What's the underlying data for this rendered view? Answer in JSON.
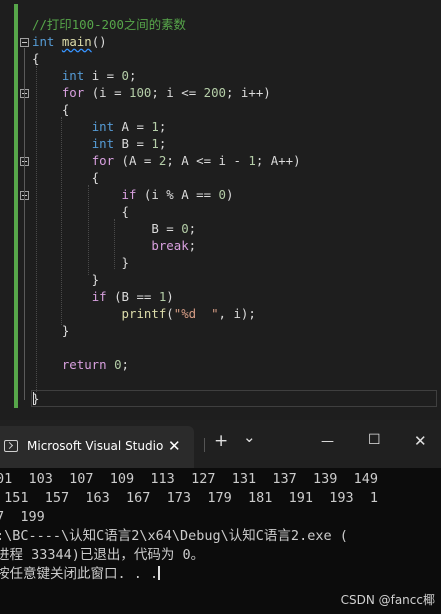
{
  "editor": {
    "lines": [
      {
        "parts": [
          {
            "c": "cm",
            "t": "//打印100-200之间的素数"
          }
        ]
      },
      {
        "parts": [
          {
            "c": "kw",
            "t": "int"
          },
          {
            "c": "",
            "t": " "
          },
          {
            "c": "fn squiggle",
            "t": "main"
          },
          {
            "c": "",
            "t": "()"
          }
        ]
      },
      {
        "parts": [
          {
            "c": "",
            "t": "{"
          }
        ]
      },
      {
        "parts": [
          {
            "c": "",
            "t": "    "
          },
          {
            "c": "kw",
            "t": "int"
          },
          {
            "c": "",
            "t": " i = "
          },
          {
            "c": "num",
            "t": "0"
          },
          {
            "c": "",
            "t": ";"
          }
        ]
      },
      {
        "parts": [
          {
            "c": "",
            "t": "    "
          },
          {
            "c": "ctl",
            "t": "for"
          },
          {
            "c": "",
            "t": " (i = "
          },
          {
            "c": "num",
            "t": "100"
          },
          {
            "c": "",
            "t": "; i <= "
          },
          {
            "c": "num",
            "t": "200"
          },
          {
            "c": "",
            "t": "; i++)"
          }
        ]
      },
      {
        "parts": [
          {
            "c": "",
            "t": "    {"
          }
        ]
      },
      {
        "parts": [
          {
            "c": "",
            "t": "        "
          },
          {
            "c": "kw",
            "t": "int"
          },
          {
            "c": "",
            "t": " A = "
          },
          {
            "c": "num",
            "t": "1"
          },
          {
            "c": "",
            "t": ";"
          }
        ]
      },
      {
        "parts": [
          {
            "c": "",
            "t": "        "
          },
          {
            "c": "kw",
            "t": "int"
          },
          {
            "c": "",
            "t": " B = "
          },
          {
            "c": "num",
            "t": "1"
          },
          {
            "c": "",
            "t": ";"
          }
        ]
      },
      {
        "parts": [
          {
            "c": "",
            "t": "        "
          },
          {
            "c": "ctl",
            "t": "for"
          },
          {
            "c": "",
            "t": " (A = "
          },
          {
            "c": "num",
            "t": "2"
          },
          {
            "c": "",
            "t": "; A <= i - "
          },
          {
            "c": "num",
            "t": "1"
          },
          {
            "c": "",
            "t": "; A++)"
          }
        ]
      },
      {
        "parts": [
          {
            "c": "",
            "t": "        {"
          }
        ]
      },
      {
        "parts": [
          {
            "c": "",
            "t": "            "
          },
          {
            "c": "ctl",
            "t": "if"
          },
          {
            "c": "",
            "t": " (i % A == "
          },
          {
            "c": "num",
            "t": "0"
          },
          {
            "c": "",
            "t": ")"
          }
        ]
      },
      {
        "parts": [
          {
            "c": "",
            "t": "            {"
          }
        ]
      },
      {
        "parts": [
          {
            "c": "",
            "t": "                B = "
          },
          {
            "c": "num",
            "t": "0"
          },
          {
            "c": "",
            "t": ";"
          }
        ]
      },
      {
        "parts": [
          {
            "c": "",
            "t": "                "
          },
          {
            "c": "ctl",
            "t": "break"
          },
          {
            "c": "",
            "t": ";"
          }
        ]
      },
      {
        "parts": [
          {
            "c": "",
            "t": "            }"
          }
        ]
      },
      {
        "parts": [
          {
            "c": "",
            "t": "        }"
          }
        ]
      },
      {
        "parts": [
          {
            "c": "",
            "t": "        "
          },
          {
            "c": "ctl",
            "t": "if"
          },
          {
            "c": "",
            "t": " (B == "
          },
          {
            "c": "num",
            "t": "1"
          },
          {
            "c": "",
            "t": ")"
          }
        ]
      },
      {
        "parts": [
          {
            "c": "",
            "t": "            "
          },
          {
            "c": "fn",
            "t": "printf"
          },
          {
            "c": "",
            "t": "("
          },
          {
            "c": "str",
            "t": "\"%d  \""
          },
          {
            "c": "",
            "t": ", i);"
          }
        ]
      },
      {
        "parts": [
          {
            "c": "",
            "t": "    }"
          }
        ]
      },
      {
        "parts": [
          {
            "c": "",
            "t": ""
          }
        ]
      },
      {
        "parts": [
          {
            "c": "",
            "t": "    "
          },
          {
            "c": "ctl",
            "t": "return"
          },
          {
            "c": "",
            "t": " "
          },
          {
            "c": "num",
            "t": "0"
          },
          {
            "c": "",
            "t": ";"
          }
        ]
      },
      {
        "parts": [
          {
            "c": "",
            "t": ""
          }
        ]
      },
      {
        "parts": [
          {
            "c": "",
            "t": "}"
          }
        ]
      }
    ]
  },
  "terminal": {
    "tab_title": "Microsoft Visual Studio",
    "tab_close": "✕",
    "new_tab": "+",
    "dropdown": "⌄",
    "minimize": "—",
    "maximize": "☐",
    "close": "✕",
    "lines": [
      "01  103  107  109  113  127  131  137  139  149",
      " 151  157  163  167  173  179  181  191  193  1",
      "7  199",
      ":\\BC----\\认知C语言2\\x64\\Debug\\认知C语言2.exe (",
      "进程 33344)已退出，代码为 0。",
      "按任意键关闭此窗口. . ."
    ]
  },
  "watermark": "CSDN @fancc椰",
  "colors": {
    "editor_bg": "#1e1e1e",
    "keyword": "#569cd6",
    "control": "#d8a0df",
    "number": "#b5cea8",
    "string": "#d69d85",
    "function": "#dcdcaa",
    "comment": "#57a64a",
    "terminal_bg": "#0c0c0c"
  }
}
